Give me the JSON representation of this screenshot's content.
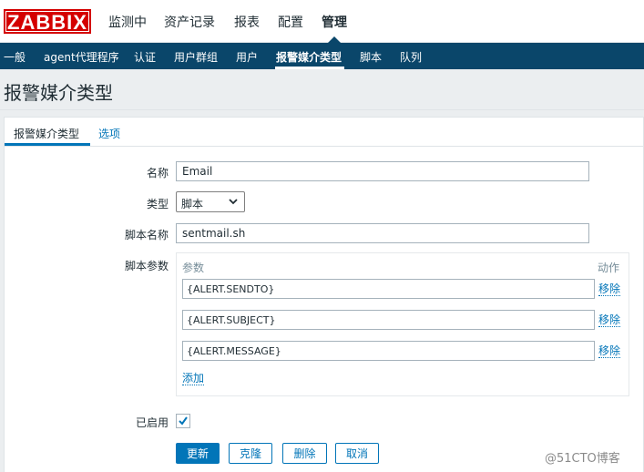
{
  "app": {
    "logo_text": "ZABBIX",
    "brand_color": "#d40000",
    "accent_color": "#0275b8",
    "nav_color": "#0a466a"
  },
  "main_menu": [
    {
      "label": "监测中",
      "active": false
    },
    {
      "label": "资产记录",
      "active": false
    },
    {
      "label": "报表",
      "active": false
    },
    {
      "label": "配置",
      "active": false
    },
    {
      "label": "管理",
      "active": true
    }
  ],
  "sub_menu": [
    {
      "label": "一般",
      "active": false
    },
    {
      "label": "agent代理程序",
      "active": false
    },
    {
      "label": "认证",
      "active": false
    },
    {
      "label": "用户群组",
      "active": false
    },
    {
      "label": "用户",
      "active": false
    },
    {
      "label": "报警媒介类型",
      "active": true
    },
    {
      "label": "脚本",
      "active": false
    },
    {
      "label": "队列",
      "active": false
    }
  ],
  "page_title": "报警媒介类型",
  "tabs": [
    {
      "label": "报警媒介类型",
      "active": true
    },
    {
      "label": "选项",
      "active": false
    }
  ],
  "form": {
    "name_label": "名称",
    "name_value": "Email",
    "type_label": "类型",
    "type_value": "脚本",
    "script_name_label": "脚本名称",
    "script_name_value": "sentmail.sh",
    "script_params_label": "脚本参数",
    "params_header": "参数",
    "action_header": "动作",
    "params": [
      {
        "value": "{ALERT.SENDTO}",
        "remove_label": "移除"
      },
      {
        "value": "{ALERT.SUBJECT}",
        "remove_label": "移除"
      },
      {
        "value": "{ALERT.MESSAGE}",
        "remove_label": "移除"
      }
    ],
    "add_label": "添加",
    "enabled_label": "已启用",
    "enabled": true
  },
  "buttons": {
    "update": "更新",
    "clone": "克隆",
    "delete": "删除",
    "cancel": "取消"
  },
  "watermark": "@51CTO博客"
}
